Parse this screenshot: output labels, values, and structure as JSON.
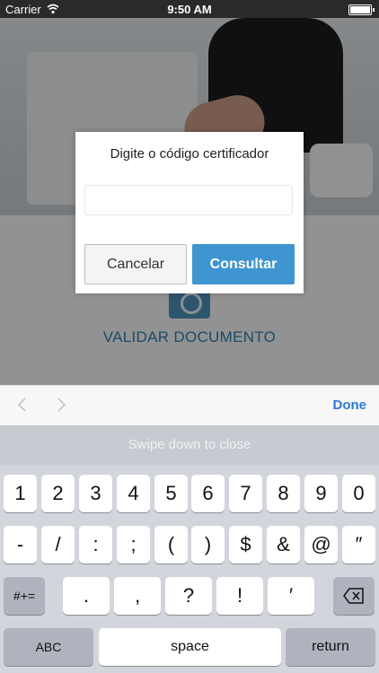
{
  "status": {
    "carrier": "Carrier",
    "time": "9:50 AM"
  },
  "app": {
    "validate_label": "VALIDAR DOCUMENTO"
  },
  "dialog": {
    "title": "Digite o código certificador",
    "input_value": "",
    "cancel_label": "Cancelar",
    "submit_label": "Consultar"
  },
  "toolbar": {
    "done_label": "Done"
  },
  "keyboard": {
    "hint": "Swipe down to close",
    "row1": [
      "1",
      "2",
      "3",
      "4",
      "5",
      "6",
      "7",
      "8",
      "9",
      "0"
    ],
    "row2": [
      "-",
      "/",
      ":",
      ";",
      "(",
      ")",
      "$",
      "&",
      "@",
      "″"
    ],
    "row3_mode": "#+=",
    "row3": [
      ".",
      ",",
      "?",
      "!",
      "′"
    ],
    "abc_label": "ABC",
    "space_label": "space",
    "return_label": "return",
    "backspace_icon": "backspace-icon"
  }
}
